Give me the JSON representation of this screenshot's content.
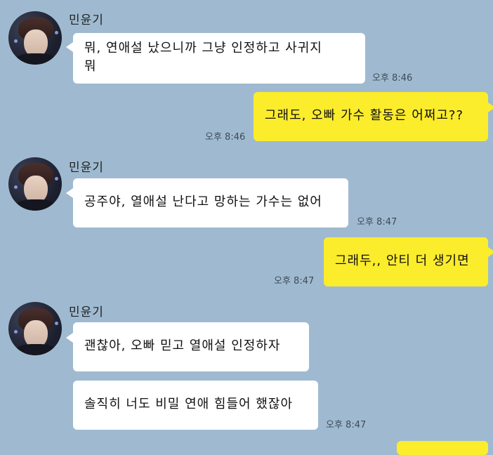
{
  "sender": {
    "name": "민윤기"
  },
  "messages": [
    {
      "id": "m1",
      "side": "in",
      "lines": [
        "뭐, 연애설 났으니까 그냥 인정하고 사귀지",
        "뭐"
      ],
      "time": "오후 8:46"
    },
    {
      "id": "m2",
      "side": "out",
      "lines": [
        "그래도, 오빠 가수 활동은 어쩌고??"
      ],
      "time": "오후 8:46"
    },
    {
      "id": "m3",
      "side": "in",
      "lines": [
        "공주야, 열애설 난다고 망하는 가수는 없어"
      ],
      "time": "오후 8:47"
    },
    {
      "id": "m4",
      "side": "out",
      "lines": [
        "그래두,, 안티 더 생기면"
      ],
      "time": "오후 8:47"
    },
    {
      "id": "m5",
      "side": "in",
      "lines": [
        "괜찮아, 오빠 믿고 열애설 인정하자"
      ],
      "time": ""
    },
    {
      "id": "m6",
      "side": "in",
      "lines": [
        "솔직히 너도 비밀 연애 힘들어 했잖아"
      ],
      "time": "오후 8:47"
    }
  ],
  "colors": {
    "background": "#9fbad0",
    "incoming_bubble": "#ffffff",
    "outgoing_bubble": "#fbec2c"
  },
  "icons": {
    "avatar": "profile-photo"
  }
}
